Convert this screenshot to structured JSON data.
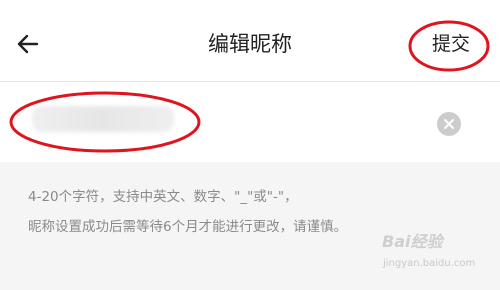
{
  "header": {
    "title": "编辑昵称",
    "submit_label": "提交",
    "back_icon": "arrow-left-icon"
  },
  "nickname": {
    "value": "",
    "clear_icon": "clear-circle-icon"
  },
  "hint": {
    "line1": "4-20个字符，支持中英文、数字、\"_\"或\"-\"，",
    "line2": "昵称设置成功后需等待6个月才能进行更改，请谨慎。"
  },
  "watermark": {
    "logo": "Bai经验",
    "url": "jingyan.baidu.com"
  },
  "colors": {
    "annotation_red": "#e0141e",
    "background": "#f5f5f5",
    "hint_text": "#8a8a8a"
  }
}
